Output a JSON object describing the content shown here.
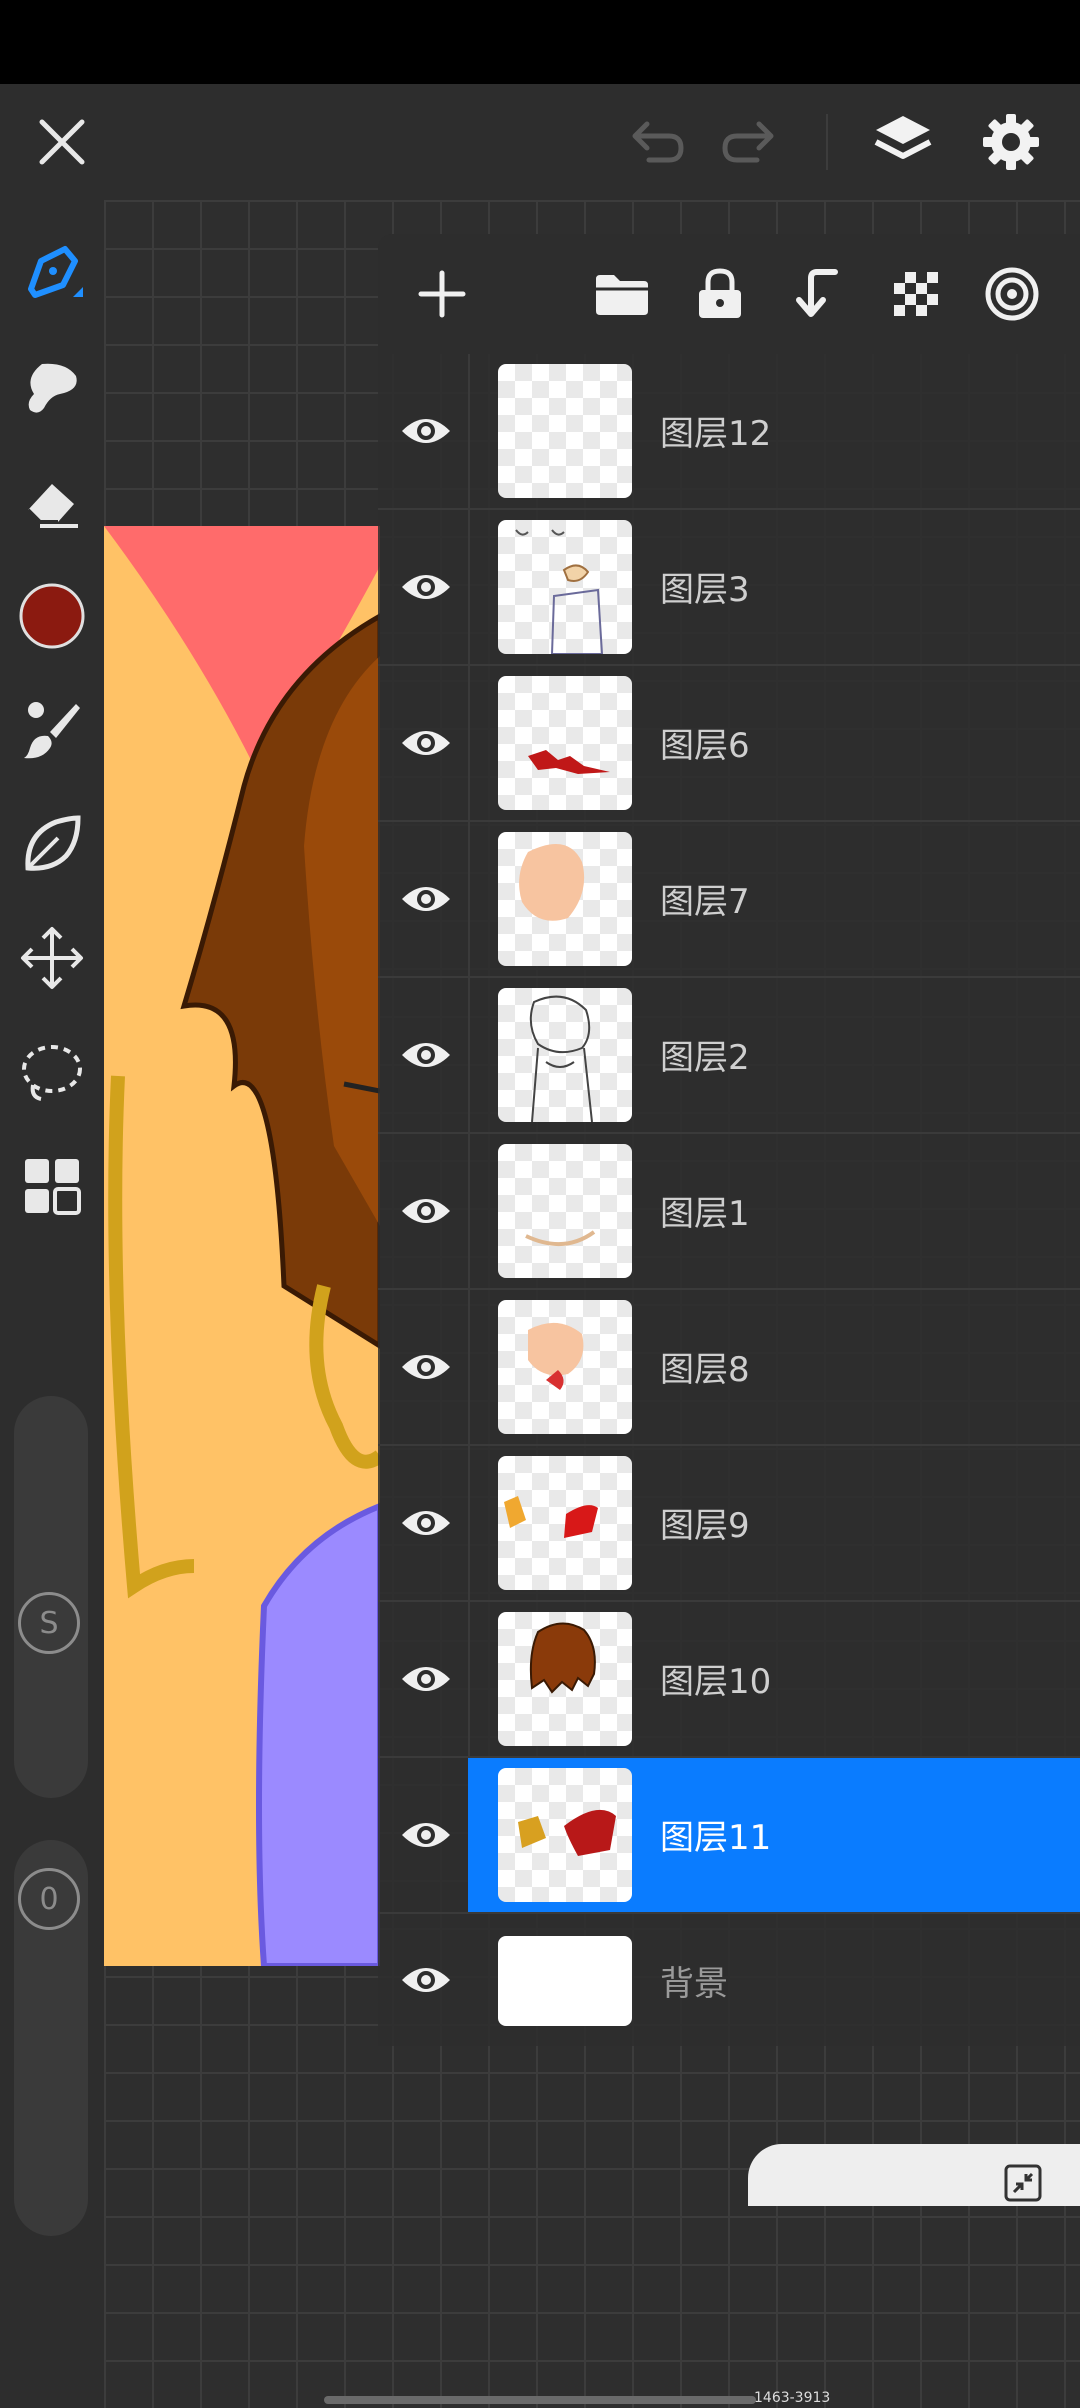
{
  "app": {
    "top_bar": {
      "close_icon": "close-icon",
      "undo_icon": "undo-icon",
      "redo_icon": "redo-icon",
      "layers_icon": "layers-icon",
      "settings_icon": "gear-icon"
    },
    "tools": [
      {
        "name": "pen-tool",
        "icon": "pen-icon",
        "active": true
      },
      {
        "name": "smudge-tool",
        "icon": "smudge-icon"
      },
      {
        "name": "eraser-tool",
        "icon": "eraser-icon"
      },
      {
        "name": "color-swatch",
        "icon": "color-circle",
        "color": "#8b1a10"
      },
      {
        "name": "brush-tool",
        "icon": "brush-icon"
      },
      {
        "name": "shape-tool",
        "icon": "leaf-icon"
      },
      {
        "name": "transform-tool",
        "icon": "move-icon"
      },
      {
        "name": "lasso-tool",
        "icon": "lasso-icon"
      },
      {
        "name": "gallery-tool",
        "icon": "grid-icon"
      }
    ],
    "sliders": {
      "size_label": "S",
      "opacity_label": "0"
    },
    "accent_color": "#0a7cff"
  },
  "layers_panel": {
    "toolbar_icons": [
      "add-icon",
      "folder-icon",
      "lock-icon",
      "merge-down-icon",
      "transparency-icon",
      "target-icon"
    ],
    "layers": [
      {
        "name": "图层12",
        "visible": true,
        "selected": false
      },
      {
        "name": "图层3",
        "visible": true,
        "selected": false
      },
      {
        "name": "图层6",
        "visible": true,
        "selected": false
      },
      {
        "name": "图层7",
        "visible": true,
        "selected": false
      },
      {
        "name": "图层2",
        "visible": true,
        "selected": false
      },
      {
        "name": "图层1",
        "visible": true,
        "selected": false
      },
      {
        "name": "图层8",
        "visible": true,
        "selected": false
      },
      {
        "name": "图层9",
        "visible": true,
        "selected": false
      },
      {
        "name": "图层10",
        "visible": true,
        "selected": false
      },
      {
        "name": "图层11",
        "visible": true,
        "selected": true
      },
      {
        "name": "背景",
        "visible": true,
        "selected": false
      }
    ]
  },
  "footer": {
    "build_label": "1463-3913",
    "collapse_icon": "collapse-icon"
  }
}
